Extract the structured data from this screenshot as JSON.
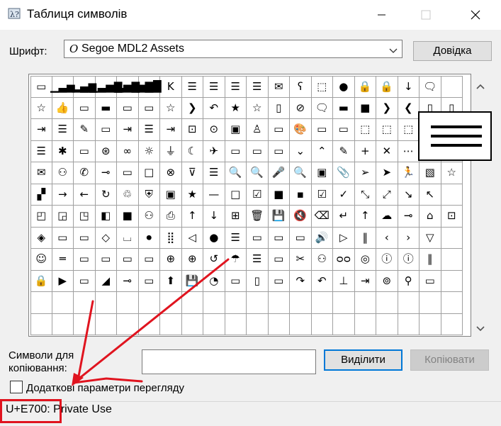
{
  "window": {
    "title": "Таблиця символів",
    "icon": "charmap-app-icon"
  },
  "font_picker": {
    "label": "Шрифт:",
    "value": "Segoe MDL2 Assets",
    "font_icon": "O",
    "help_button": "Довідка"
  },
  "grid": {
    "rows": [
      [
        "▭",
        "▁▃▅",
        "▂▄▆",
        "▁▃▅▇",
        "▃▅▇",
        "▅▇█",
        "K",
        "☰",
        "☰",
        "☰",
        "☰",
        "✉",
        "ʕ",
        "⬚",
        "●",
        "🔒",
        "🔒",
        "↓",
        "🗨"
      ],
      [
        "☆",
        "👍",
        "▭",
        "▬",
        "▭",
        "▭",
        "☆",
        "❯",
        "↶",
        "★",
        "☆",
        "▯",
        "⊘",
        "🗨",
        "▬",
        "■",
        "❯",
        "❮",
        "▯",
        "▯"
      ],
      [
        "⇥",
        "☰",
        "✎",
        "▭",
        "⇥",
        "☰",
        "⇥",
        "⊡",
        "⊙",
        "▣",
        "♙",
        "▭",
        "🎨",
        "▭",
        "▭",
        "⬚",
        "⬚",
        "⬚",
        "⬚",
        "⬚"
      ],
      [
        "☰",
        "✱",
        "▭",
        "⊛",
        "∞",
        "☼",
        "⏚",
        "☾",
        "✈",
        "▭",
        "▭",
        "▭",
        "⌄",
        "⌃",
        "✎",
        "+",
        "✕",
        "⋯",
        "⚙",
        "▯"
      ],
      [
        "✉",
        "⚇",
        "✆",
        "⊸",
        "▭",
        "□",
        "⊗",
        "⊽",
        "☰",
        "🔍",
        "🔍",
        "🎤",
        "🔍",
        "▣",
        "📎",
        "➢",
        "➤",
        "🏃",
        "▧",
        "☆"
      ],
      [
        "▞",
        "→",
        "←",
        "↻",
        "♲",
        "⛨",
        "▣",
        "★",
        "—",
        "□",
        "☑",
        "■",
        "▪",
        "☑",
        "✓",
        "⤡",
        "⤢",
        "↘",
        "↖"
      ],
      [
        "◰",
        "◲",
        "◳",
        "◧",
        "■",
        "⚇",
        "⎙",
        "↑",
        "↓",
        "⊞",
        "🗑",
        "💾",
        "🔇",
        "⌫",
        "↵",
        "↑",
        "☁",
        "⊸",
        "⌂",
        "⊡"
      ],
      [
        "◈",
        "▭",
        "▭",
        "◇",
        "⌴",
        "⏺",
        "⣿",
        "◁",
        "●",
        "☰",
        "▭",
        "▭",
        "▭",
        "🔊",
        "▷",
        "‖",
        "‹",
        "›",
        "▽"
      ],
      [
        "☺",
        "═",
        "▭",
        "▭",
        "▭",
        "▭",
        "⊕",
        "⊕",
        "↺",
        "☂",
        "☰",
        "▭",
        "✂",
        "⚇",
        "ᴑᴑ",
        "◎",
        "ⓘ",
        "ⓘ",
        "‖"
      ],
      [
        "🔒",
        "▶",
        "▭",
        "◢",
        "⊸",
        "▭",
        "⬆",
        "💾",
        "◔",
        "▭",
        "▯",
        "▭",
        "↷",
        "↶",
        "⊥",
        "⇥",
        "⊚",
        "⚲",
        "▭"
      ],
      [
        "",
        "",
        "",
        "",
        "",
        "",
        "",
        "",
        "",
        "",
        "",
        "",
        "",
        "",
        "",
        "",
        "",
        "",
        "",
        ""
      ],
      [
        "",
        "",
        "",
        "",
        "",
        "",
        "",
        "",
        "",
        "",
        "",
        "",
        "",
        "",
        "",
        "",
        "",
        "",
        "",
        ""
      ]
    ]
  },
  "magnifier": {
    "glyph": "hamburger-menu-icon"
  },
  "copy_area": {
    "label_line1": "Символи для",
    "label_line2": "копіювання:",
    "value": "",
    "select_button": "Виділити",
    "copy_button": "Копіювати"
  },
  "advanced": {
    "label": "Додаткові параметри перегляду",
    "checked": false
  },
  "status": {
    "text": "U+E700: Private Use"
  },
  "colors": {
    "annotation": "#e0141f",
    "accent": "#0078d7"
  }
}
